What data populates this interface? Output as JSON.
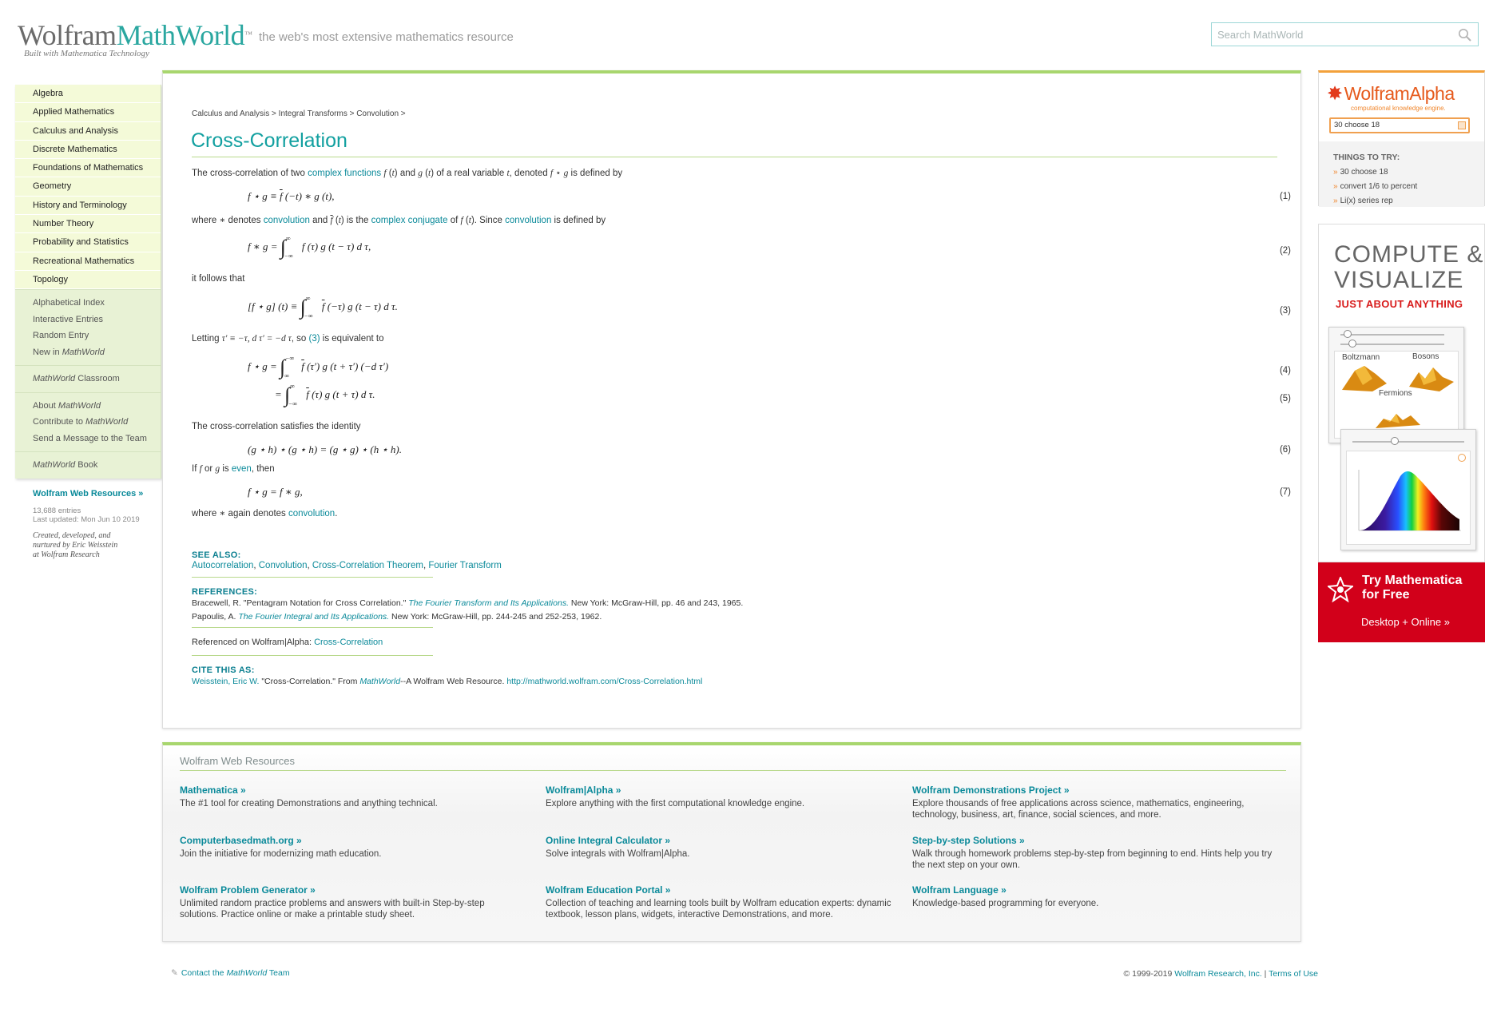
{
  "header": {
    "logo_word1": "Wolfram",
    "logo_word2": "MathWorld",
    "logo_sub": "Built with Mathematica Technology",
    "tagline": "the web's most extensive mathematics resource",
    "search_placeholder": "Search MathWorld"
  },
  "leftnav": {
    "topics": [
      "Algebra",
      "Applied Mathematics",
      "Calculus and Analysis",
      "Discrete Mathematics",
      "Foundations of Mathematics",
      "Geometry",
      "History and Terminology",
      "Number Theory",
      "Probability and Statistics",
      "Recreational Mathematics",
      "Topology"
    ],
    "group1": [
      "Alphabetical Index",
      "Interactive Entries",
      "Random Entry",
      "New in "
    ],
    "group1_italic": "MathWorld",
    "classroom_italic": "MathWorld",
    "classroom_rest": " Classroom",
    "group3_about": "About ",
    "group3_contribute": "Contribute to ",
    "group3_italic": "MathWorld",
    "group3_send": "Send a Message to the Team",
    "book_italic": "MathWorld",
    "book_rest": " Book"
  },
  "webres": {
    "title": "Wolfram Web Resources »",
    "entries": "13,688 entries",
    "updated": "Last updated: Mon Jun 10 2019",
    "credit1": "Created, developed, and",
    "credit2": "nurtured by Eric Weisstein",
    "credit3": "at Wolfram Research"
  },
  "article": {
    "breadcrumb": "Calculus and Analysis > Integral Transforms > Convolution >",
    "title": "Cross-Correlation",
    "p1_a": "The cross-correlation of two ",
    "p1_link": "complex functions",
    "p1_b": " and ",
    "p1_c": " of a real variable ",
    "p1_d": ", denoted ",
    "p1_e": " is defined by",
    "p2_a": "where ",
    "p2_b": " denotes ",
    "p2_link1": "convolution",
    "p2_c": " and ",
    "p2_d": " is the ",
    "p2_link2": "complex conjugate",
    "p2_e": " of ",
    "p2_f": ". Since ",
    "p2_link3": "convolution",
    "p2_g": " is defined by",
    "p3": "it follows that",
    "p4_a": "Letting ",
    "p4_b": ", so ",
    "p4_link": "(3)",
    "p4_c": " is equivalent to",
    "p5": "The cross-correlation satisfies the identity",
    "p6_a": "If ",
    "p6_b": " or ",
    "p6_c": " is ",
    "p6_link": "even",
    "p6_d": ", then",
    "p7_a": "where ",
    "p7_b": " again denotes ",
    "p7_link": "convolution",
    "p7_c": ".",
    "eq_numbers": [
      "(1)",
      "(2)",
      "(3)",
      "(4)",
      "(5)",
      "(6)",
      "(7)"
    ],
    "see_also_title": "SEE ALSO:",
    "see_also": [
      "Autocorrelation",
      "Convolution",
      "Cross-Correlation Theorem",
      "Fourier Transform"
    ],
    "references_title": "REFERENCES:",
    "ref1_a": "Bracewell, R. \"Pentagram Notation for Cross Correlation.\" ",
    "ref1_i": "The Fourier Transform and Its Applications.",
    "ref1_b": " New York: McGraw-Hill, pp. 46 and 243, 1965.",
    "ref2_a": "Papoulis, A. ",
    "ref2_i": "The Fourier Integral and Its Applications.",
    "ref2_b": " New York: McGraw-Hill, pp. 244-245 and 252-253, 1962.",
    "wa_ref_a": "Referenced on Wolfram|Alpha: ",
    "wa_ref_link": "Cross-Correlation",
    "cite_title": "CITE THIS AS:",
    "cite_author": "Weisstein, Eric W.",
    "cite_a": " \"Cross-Correlation.\" From ",
    "cite_i": "MathWorld",
    "cite_b": "--A Wolfram Web Resource. ",
    "cite_url": "http://mathworld.wolfram.com/Cross-Correlation.html"
  },
  "wolframalpha": {
    "logo": "WolframAlpha",
    "sub": "computational knowledge engine.",
    "input_value": "30 choose 18",
    "things_title": "THINGS TO TRY:",
    "examples": [
      "30 choose 18",
      "convert 1/6 to percent",
      "Li(x) series rep"
    ]
  },
  "promo": {
    "line1": "COMPUTE &",
    "line2": "VISUALIZE",
    "sub": "JUST ABOUT ANYTHING",
    "label1": "Boltzmann",
    "label2": "Bosons",
    "label3": "Fermions",
    "try_line1": "Try Mathematica",
    "try_line2": "for Free",
    "try_link": "Desktop + Online »",
    "colors": {
      "red": "#d2001a",
      "orange": "#e0891c"
    }
  },
  "resources": {
    "title": "Wolfram Web Resources",
    "items": [
      {
        "title": "Mathematica »",
        "desc": "The #1 tool for creating Demonstrations and anything technical."
      },
      {
        "title": "Wolfram|Alpha »",
        "desc": "Explore anything with the first computational knowledge engine."
      },
      {
        "title": "Wolfram Demonstrations Project »",
        "desc": "Explore thousands of free applications across science, mathematics, engineering, technology, business, art, finance, social sciences, and more."
      },
      {
        "title": "Computerbasedmath.org »",
        "desc": "Join the initiative for modernizing math education."
      },
      {
        "title": "Online Integral Calculator »",
        "desc": "Solve integrals with Wolfram|Alpha."
      },
      {
        "title": "Step-by-step Solutions »",
        "desc": "Walk through homework problems step-by-step from beginning to end. Hints help you try the next step on your own."
      },
      {
        "title": "Wolfram Problem Generator »",
        "desc": "Unlimited random practice problems and answers with built-in Step-by-step solutions. Practice online or make a printable study sheet."
      },
      {
        "title": "Wolfram Education Portal »",
        "desc": "Collection of teaching and learning tools built by Wolfram education experts: dynamic textbook, lesson plans, widgets, interactive Demonstrations, and more."
      },
      {
        "title": "Wolfram Language »",
        "desc": "Knowledge-based programming for everyone."
      }
    ]
  },
  "footer": {
    "contact_a": "Contact the ",
    "contact_i": "MathWorld",
    "contact_b": " Team",
    "copyright": "© 1999-2019 ",
    "company": "Wolfram Research, Inc.",
    "sep": " | ",
    "terms": "Terms of Use"
  }
}
